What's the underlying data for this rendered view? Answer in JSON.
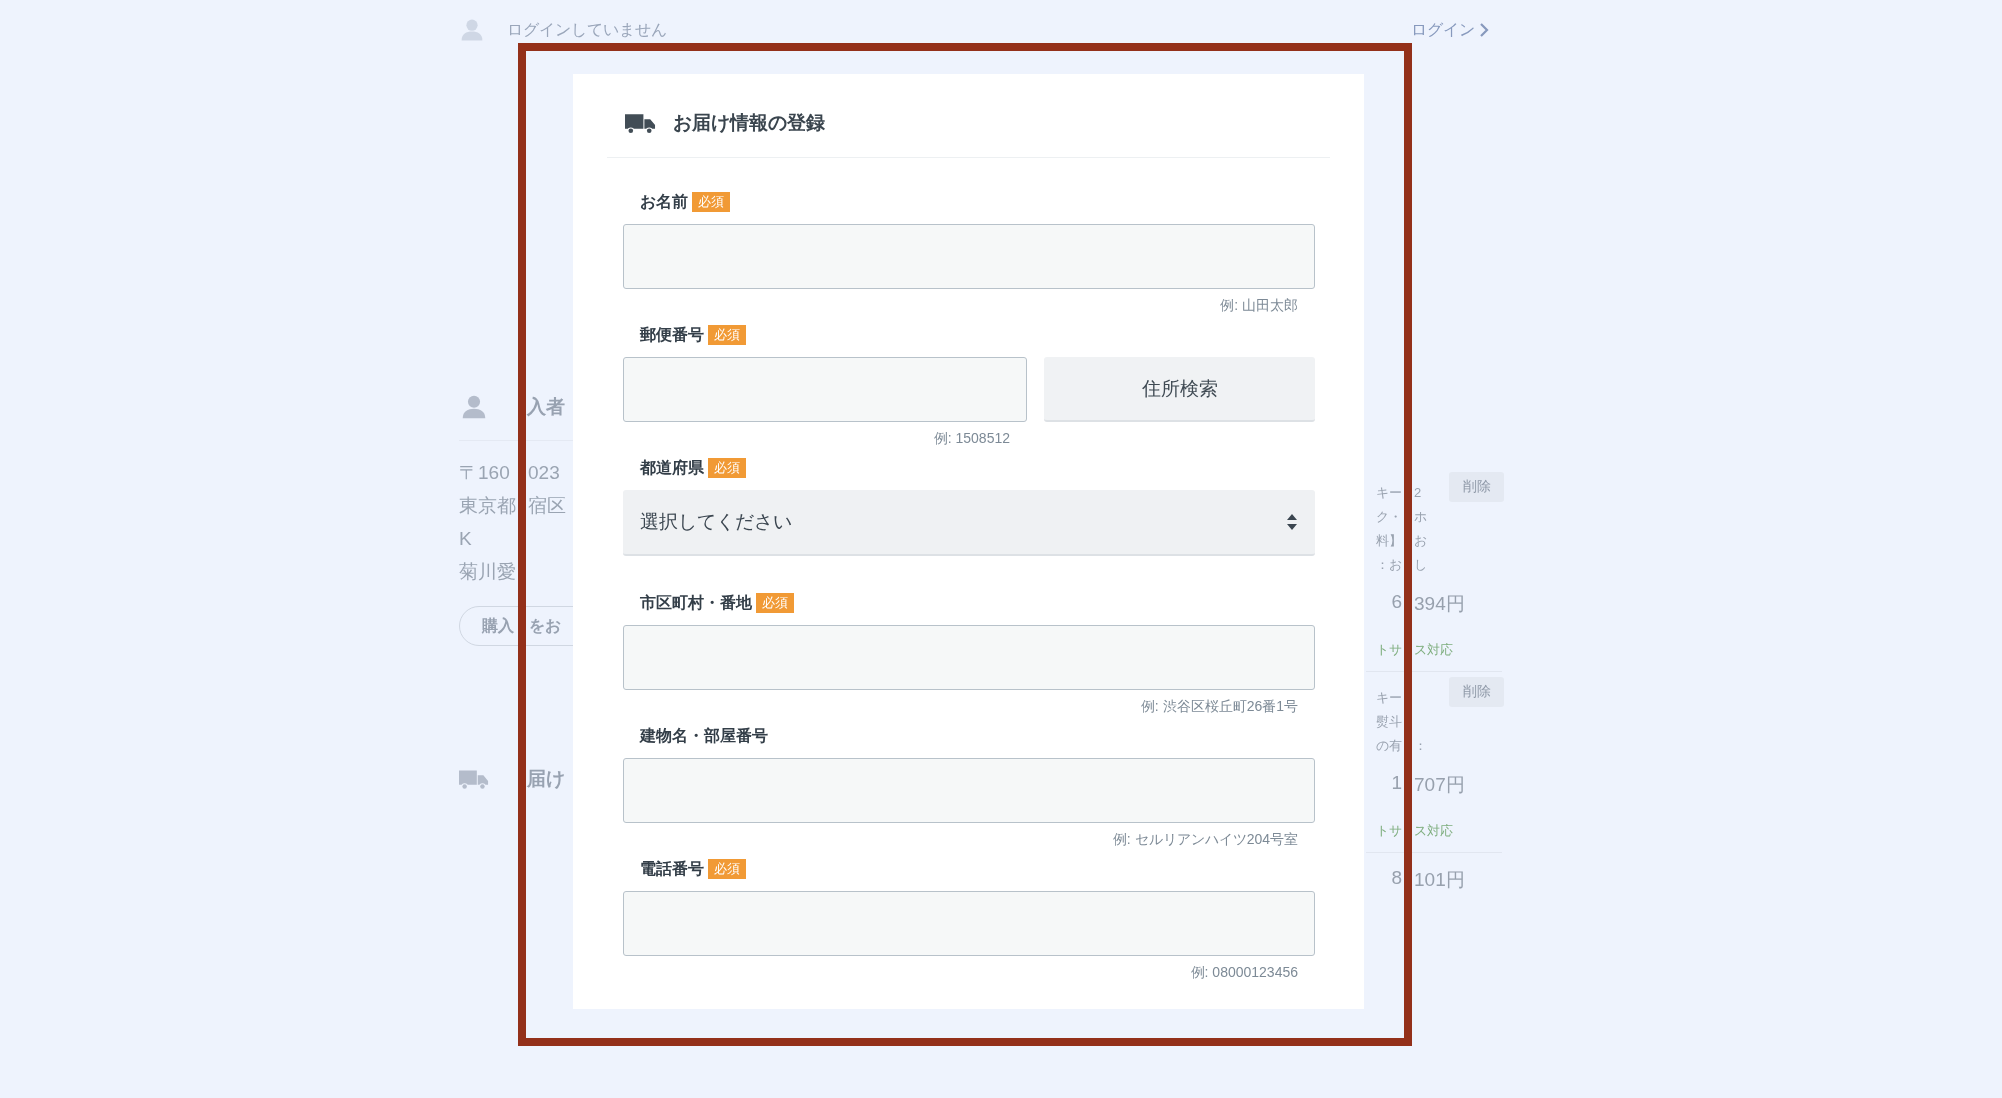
{
  "top_bar": {
    "status": "ログインしていません",
    "login_link": "ログイン"
  },
  "buyer": {
    "title": "入者",
    "address_lines": [
      {
        "text": "〒160",
        "after": "023"
      },
      {
        "text": "東京都",
        "after": "宿区"
      },
      {
        "text": "K"
      },
      {
        "text": "菊川愛"
      }
    ],
    "button": {
      "text": "購入",
      "after": "をお"
    }
  },
  "delivery_section": {
    "title": "届け"
  },
  "cart_items": [
    {
      "lines": [
        {
          "text": "キー",
          "after": "2"
        },
        {
          "text": "ク・",
          "after": "ホ"
        },
        {
          "text": "料】",
          "after": "お"
        },
        {
          "text": "：お",
          "after": "し"
        }
      ],
      "delete": "削除",
      "price": {
        "text": "6",
        "after": "394円"
      },
      "service": {
        "text": "トサ",
        "after": "ス対応"
      }
    },
    {
      "lines": [
        {
          "text": "キー"
        },
        {
          "text": "熨斗"
        },
        {
          "text": "の有",
          "after": "："
        }
      ],
      "delete": "削除",
      "price": {
        "text": "1",
        "after": "707円"
      },
      "service": {
        "text": "トサ",
        "after": "ス対応"
      }
    },
    {
      "price": {
        "text": "8",
        "after": "101円"
      }
    }
  ],
  "modal": {
    "title": "お届け情報の登録",
    "fields": [
      {
        "kind": "text",
        "label": "お名前",
        "badge": "必須",
        "hint": "例: 山田太郎"
      },
      {
        "kind": "postal",
        "label": "郵便番号",
        "badge": "必須",
        "hint": "例: 1508512",
        "button": "住所検索"
      },
      {
        "kind": "select",
        "label": "都道府県",
        "badge": "必須",
        "value": "選択してください"
      },
      {
        "kind": "text",
        "label": "市区町村・番地",
        "badge": "必須",
        "hint": "例: 渋谷区桜丘町26番1号"
      },
      {
        "kind": "text",
        "label": "建物名・部屋番号",
        "hint": "例: セルリアンハイツ204号室"
      },
      {
        "kind": "text",
        "label": "電話番号",
        "badge": "必須",
        "hint": "例: 08000123456"
      }
    ]
  }
}
